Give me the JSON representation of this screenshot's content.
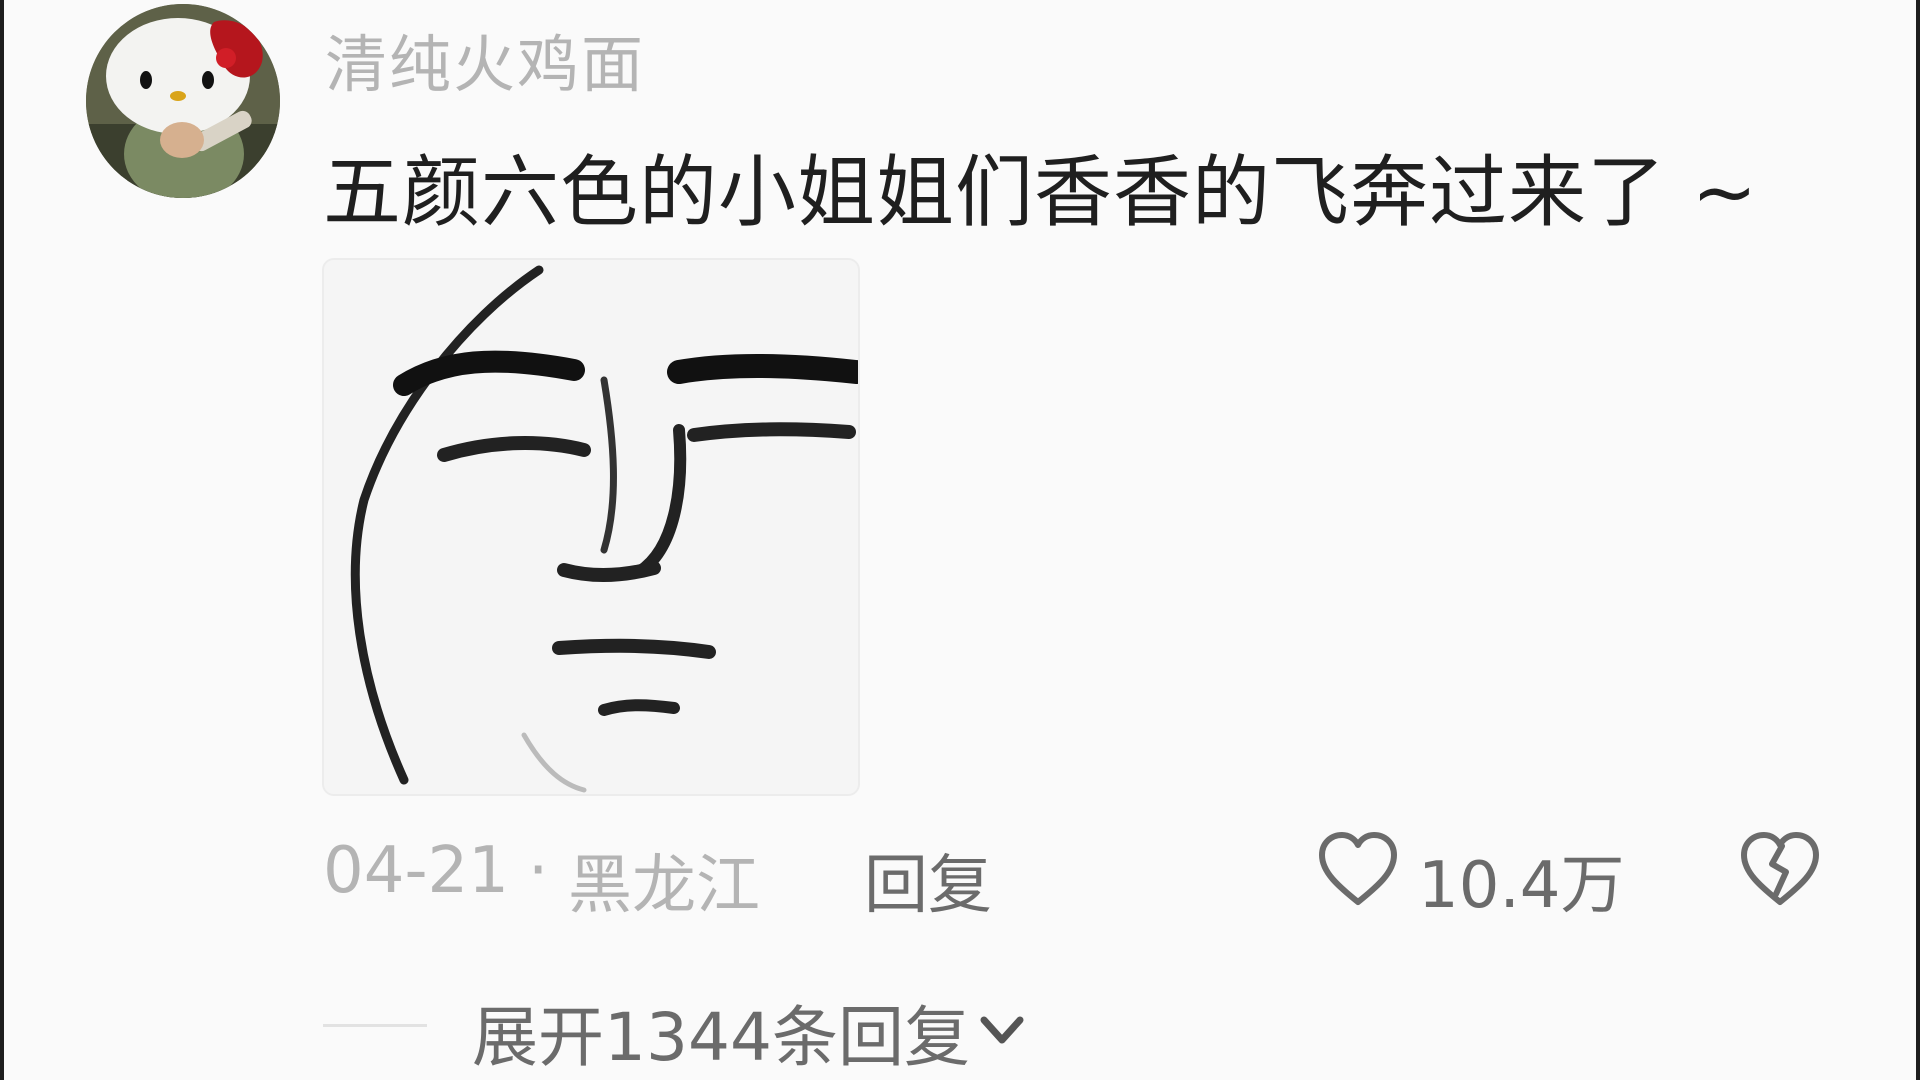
{
  "comment": {
    "username": "清纯火鸡面",
    "text": "五颜六色的小姐姐们香香的飞奔过来了 ~",
    "sticker_icon": "smug-face-meme-sticker",
    "date": "04-21",
    "separator": "·",
    "location": "黑龙江",
    "reply_label": "回复",
    "like_icon": "heart-outline-icon",
    "like_count": "10.4万",
    "dislike_icon": "broken-heart-icon",
    "expand_label": "展开1344条回复",
    "expand_icon": "chevron-down-icon"
  },
  "colors": {
    "background": "#fafafa",
    "username": "#b4b4b4",
    "text": "#1f1f1f",
    "meta": "#b4b4b4",
    "action": "#6b6b6b"
  }
}
